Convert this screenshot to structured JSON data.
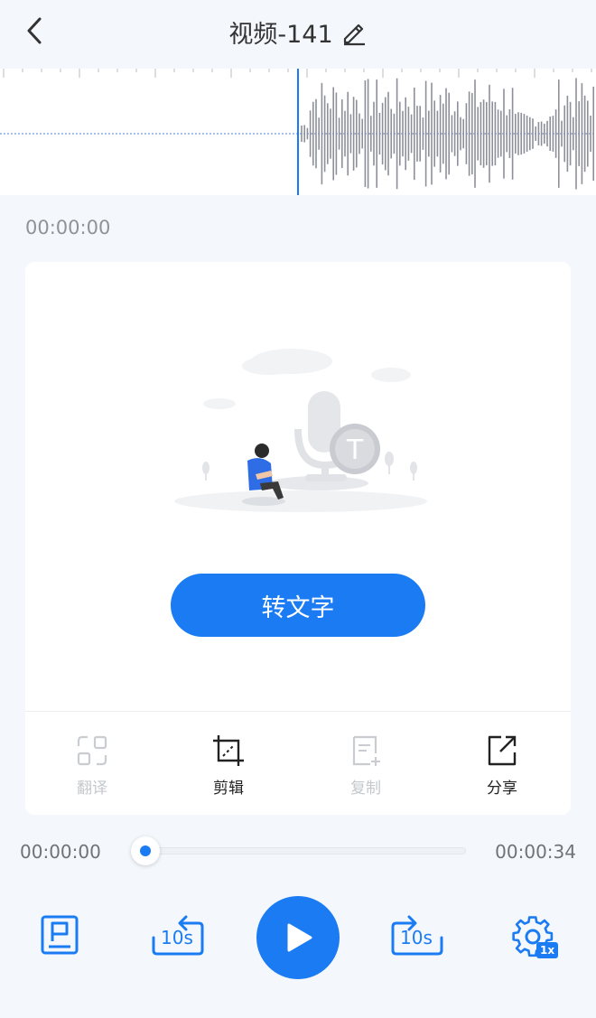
{
  "header": {
    "title": "视频-141",
    "back_icon": "chevron-left-icon",
    "edit_icon": "pencil-icon"
  },
  "waveform": {
    "playhead_color": "#1a7bf3",
    "wave_color": "#8e9099",
    "playhead_fraction": 0.0
  },
  "current_position_top": "00:00:00",
  "empty_state": {
    "illustration": "microphone-text-illustration",
    "convert_button_label": "转文字"
  },
  "toolbar": {
    "items": [
      {
        "label": "翻译",
        "icon": "translate-icon",
        "enabled": false
      },
      {
        "label": "剪辑",
        "icon": "crop-icon",
        "enabled": true
      },
      {
        "label": "复制",
        "icon": "copy-icon",
        "enabled": false
      },
      {
        "label": "分享",
        "icon": "share-icon",
        "enabled": true
      }
    ]
  },
  "player": {
    "current_time": "00:00:00",
    "total_time": "00:00:34",
    "progress_fraction": 0.0,
    "rewind_label": "10s",
    "forward_label": "10s",
    "speed_badge": "1x",
    "accent_color": "#1a7bf3"
  }
}
